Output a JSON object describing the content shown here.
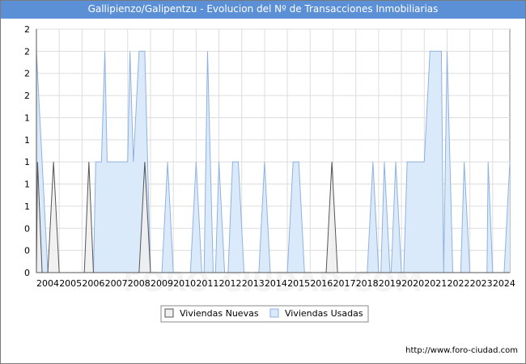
{
  "title": "Gallipienzo/Galipentzu - Evolucion del Nº de Transacciones Inmobiliarias",
  "footer": "http://www.foro-ciudad.com",
  "watermark": "FORO-CIUDAD.COM",
  "colors": {
    "title_bg": "#5b8fd6",
    "nuevas_fill": "#efefef",
    "nuevas_stroke": "#555555",
    "usadas_fill": "#dbeafb",
    "usadas_stroke": "#8fb2e0"
  },
  "chart_data": {
    "type": "area",
    "title": "Gallipienzo/Galipentzu - Evolucion del Nº de Transacciones Inmobiliarias",
    "xlabel": "",
    "ylabel": "",
    "ylim": [
      0,
      2.2
    ],
    "yticks": [
      0,
      0.2,
      0.4,
      0.6,
      0.8,
      1.0,
      1.2,
      1.4,
      1.6,
      1.8,
      2.0,
      2.2
    ],
    "ytick_labels": [
      "0",
      "0",
      "0",
      "1",
      "1",
      "1",
      "1",
      "1",
      "2",
      "2",
      "2",
      "2"
    ],
    "xlim": [
      2004,
      2024.75
    ],
    "xticks": [
      2004,
      2005,
      2006,
      2007,
      2008,
      2009,
      2010,
      2011,
      2012,
      2013,
      2014,
      2015,
      2016,
      2017,
      2018,
      2019,
      2020,
      2021,
      2022,
      2023,
      2024
    ],
    "grid": true,
    "legend": "bottom-center",
    "series": [
      {
        "name": "Viviendas Nuevas",
        "points": [
          [
            2004,
            0
          ],
          [
            2004.05,
            1
          ],
          [
            2004.25,
            0
          ],
          [
            2004.5,
            0
          ],
          [
            2004.75,
            1
          ],
          [
            2005,
            0
          ],
          [
            2006.1,
            0
          ],
          [
            2006.3,
            1
          ],
          [
            2006.5,
            0
          ],
          [
            2008.5,
            0
          ],
          [
            2008.75,
            1
          ],
          [
            2009,
            0
          ],
          [
            2016.7,
            0
          ],
          [
            2016.95,
            1
          ],
          [
            2017.2,
            0
          ]
        ]
      },
      {
        "name": "Viviendas Usadas",
        "points": [
          [
            2004,
            2
          ],
          [
            2004.25,
            1
          ],
          [
            2004.5,
            0
          ],
          [
            2006.5,
            0
          ],
          [
            2006.6,
            1
          ],
          [
            2006.85,
            1
          ],
          [
            2007,
            2
          ],
          [
            2007.1,
            1
          ],
          [
            2007.75,
            1
          ],
          [
            2008,
            1
          ],
          [
            2008.1,
            2
          ],
          [
            2008.25,
            1
          ],
          [
            2008.5,
            2
          ],
          [
            2008.75,
            2
          ],
          [
            2009,
            0
          ],
          [
            2009.5,
            0
          ],
          [
            2009.75,
            1
          ],
          [
            2010,
            0
          ],
          [
            2010.75,
            0
          ],
          [
            2011,
            1
          ],
          [
            2011.25,
            0
          ],
          [
            2011.35,
            0
          ],
          [
            2011.5,
            2
          ],
          [
            2011.75,
            0
          ],
          [
            2011.85,
            0
          ],
          [
            2012,
            1
          ],
          [
            2012.25,
            0
          ],
          [
            2012.4,
            0
          ],
          [
            2012.6,
            1
          ],
          [
            2012.85,
            1
          ],
          [
            2013.1,
            0
          ],
          [
            2013.75,
            0
          ],
          [
            2014,
            1
          ],
          [
            2014.25,
            0
          ],
          [
            2015,
            0
          ],
          [
            2015.25,
            1
          ],
          [
            2015.5,
            1
          ],
          [
            2015.75,
            0
          ],
          [
            2018.5,
            0
          ],
          [
            2018.75,
            1
          ],
          [
            2019,
            0
          ],
          [
            2019.1,
            0
          ],
          [
            2019.25,
            1
          ],
          [
            2019.5,
            0
          ],
          [
            2019.55,
            0
          ],
          [
            2019.75,
            1
          ],
          [
            2020,
            0
          ],
          [
            2020.1,
            0
          ],
          [
            2020.25,
            1
          ],
          [
            2020.75,
            1
          ],
          [
            2021,
            1
          ],
          [
            2021.25,
            2
          ],
          [
            2021.5,
            2
          ],
          [
            2021.75,
            2
          ],
          [
            2021.85,
            0
          ],
          [
            2022,
            2
          ],
          [
            2022.25,
            0
          ],
          [
            2022.6,
            0
          ],
          [
            2022.75,
            1
          ],
          [
            2023,
            0
          ],
          [
            2023.75,
            0
          ],
          [
            2023.8,
            1
          ],
          [
            2024,
            0
          ],
          [
            2024.5,
            0
          ],
          [
            2024.75,
            1
          ]
        ]
      }
    ]
  }
}
